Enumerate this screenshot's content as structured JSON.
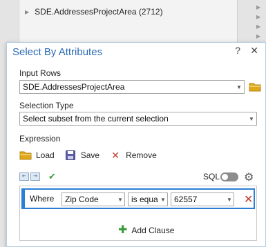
{
  "background": {
    "layer_name": "SDE.AddressesProjectArea (2712)"
  },
  "dialog": {
    "title": "Select By Attributes",
    "help_glyph": "?",
    "close_glyph": "✕",
    "input_rows": {
      "label": "Input Rows",
      "value": "SDE.AddressesProjectArea"
    },
    "selection_type": {
      "label": "Selection Type",
      "value": "Select subset from the current selection"
    },
    "expression": {
      "label": "Expression",
      "load_label": "Load",
      "save_label": "Save",
      "remove_label": "Remove",
      "sql_label": "SQL",
      "sql_enabled": false,
      "clause": {
        "where_label": "Where",
        "field": "Zip Code",
        "operator": "is equa",
        "value": "62557"
      },
      "add_clause_label": "Add Clause"
    }
  },
  "colors": {
    "title": "#2a6bb3",
    "clause_accent": "#2a7fd4",
    "remove": "#c0392b",
    "valid_check": "#3a9a3a",
    "folder": "#e0a81c"
  }
}
